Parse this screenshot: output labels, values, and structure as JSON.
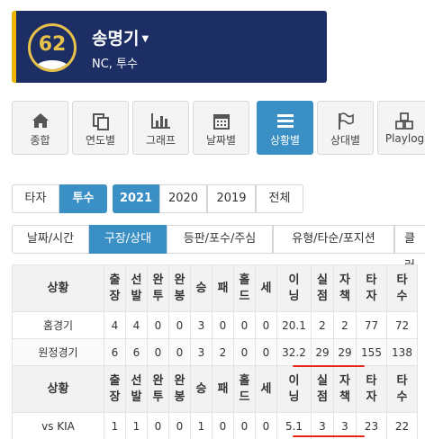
{
  "player": {
    "number": "62",
    "name": "송명기",
    "sub": "NC, 투수"
  },
  "tools": [
    {
      "label": "종합",
      "icon": "home-icon"
    },
    {
      "label": "연도별",
      "icon": "copy-icon"
    },
    {
      "label": "그래프",
      "icon": "bar-chart-icon"
    },
    {
      "label": "날짜별",
      "icon": "calendar-icon"
    },
    {
      "label": "상황별",
      "icon": "list-icon",
      "active": true
    },
    {
      "label": "상대별",
      "icon": "flag-icon"
    },
    {
      "label": "Playlog",
      "icon": "cubes-icon"
    }
  ],
  "type_toggle": {
    "batter": "타자",
    "pitcher": "투수"
  },
  "seasons": {
    "y2021": "2021",
    "y2020": "2020",
    "y2019": "2019",
    "all": "전체"
  },
  "tabs": [
    "날짜/시간",
    "구장/상대",
    "등판/포수/주심",
    "유형/타순/포지션",
    "클러"
  ],
  "table": {
    "headers": [
      "상황",
      "출\n장",
      "선\n발",
      "완\n투",
      "완\n봉",
      "승",
      "패",
      "홀\n드",
      "세",
      "이\n닝",
      "실\n점",
      "자\n책",
      "타\n자",
      "타\n수"
    ],
    "rows": [
      [
        "홈경기",
        "4",
        "4",
        "0",
        "0",
        "3",
        "0",
        "0",
        "0",
        "20.1",
        "2",
        "2",
        "77",
        "72"
      ],
      [
        "원정경기",
        "6",
        "6",
        "0",
        "0",
        "3",
        "2",
        "0",
        "0",
        "32.2",
        "29",
        "29",
        "155",
        "138"
      ]
    ],
    "rows2": [
      [
        "vs KIA",
        "1",
        "1",
        "0",
        "0",
        "1",
        "0",
        "0",
        "0",
        "5.1",
        "3",
        "3",
        "23",
        "22"
      ]
    ]
  },
  "colors": {
    "header_bg": "#1c2e64",
    "accent": "#3a8fc4",
    "highlight": "#e8261d"
  }
}
